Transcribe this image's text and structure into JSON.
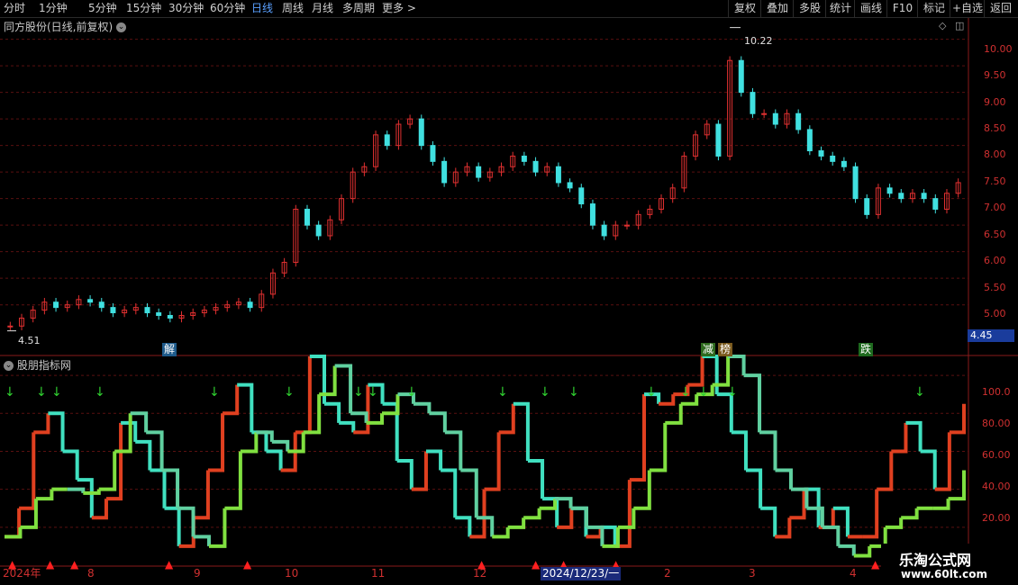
{
  "toolbar": {
    "periods": [
      "分时",
      "1分钟",
      "5分钟",
      "15分钟",
      "30分钟",
      "60分钟",
      "日线",
      "周线",
      "月线",
      "多周期",
      "更多 >"
    ],
    "active_period": "日线",
    "actions": [
      "复权",
      "叠加",
      "多股",
      "统计",
      "画线",
      "F10",
      "标记",
      "+自选",
      "返回"
    ]
  },
  "main_panel": {
    "title": "同方股份(日线,前复权)",
    "high_label": "10.22",
    "low_label": "4.51",
    "price_axis": [
      "10.00",
      "9.50",
      "9.00",
      "8.50",
      "8.00",
      "7.50",
      "7.00",
      "6.50",
      "6.00",
      "5.50",
      "5.00"
    ],
    "current_price_tag": "4.45",
    "markers": [
      {
        "text": "解",
        "color": "#2a6a9a"
      },
      {
        "text": "减",
        "color": "#3a7a2a"
      },
      {
        "text": "榜",
        "color": "#8a6a2a"
      },
      {
        "text": "跌",
        "color": "#2a7a2a"
      }
    ],
    "up_color": "#e03030",
    "down_color": "#40e0e0"
  },
  "indicator_panel": {
    "title": "股朋指标网",
    "axis": [
      "100.0",
      "80.00",
      "60.00",
      "40.00",
      "20.00"
    ]
  },
  "date_axis": {
    "labels": [
      "2024年",
      "8",
      "9",
      "10",
      "11",
      "12",
      "2",
      "3",
      "4"
    ],
    "highlight": "2024/12/23/一"
  },
  "watermark": {
    "title": "乐淘公式网",
    "url": "www.60lt.com"
  },
  "chart_data": {
    "type": "candlestick",
    "title": "同方股份(日线,前复权)",
    "ylim": [
      4.3,
      10.4
    ],
    "y_ticks": [
      5.0,
      5.5,
      6.0,
      6.5,
      7.0,
      7.5,
      8.0,
      8.5,
      9.0,
      9.5,
      10.0
    ],
    "annotated_high": 10.22,
    "annotated_low": 4.51,
    "close_path": [
      4.6,
      4.75,
      4.9,
      5.05,
      4.95,
      5.0,
      5.1,
      5.05,
      4.95,
      4.85,
      4.9,
      4.95,
      4.85,
      4.8,
      4.75,
      4.8,
      4.85,
      4.9,
      4.95,
      5.0,
      5.05,
      4.95,
      5.2,
      5.6,
      5.8,
      6.8,
      6.5,
      6.3,
      6.6,
      7.0,
      7.5,
      7.6,
      8.2,
      8.0,
      8.4,
      8.5,
      8.0,
      7.7,
      7.3,
      7.5,
      7.6,
      7.4,
      7.5,
      7.6,
      7.8,
      7.7,
      7.5,
      7.6,
      7.3,
      7.2,
      6.9,
      6.5,
      6.3,
      6.5,
      6.5,
      6.7,
      6.8,
      7.0,
      7.2,
      7.8,
      8.2,
      8.4,
      7.8,
      9.6,
      9.0,
      8.6,
      8.6,
      8.4,
      8.6,
      8.3,
      7.9,
      7.8,
      7.7,
      7.6,
      7.0,
      6.7,
      7.2,
      7.1,
      7.0,
      7.1,
      7.0,
      6.8,
      7.1,
      7.3
    ],
    "indicator": {
      "ylim": [
        0,
        110
      ],
      "y_ticks": [
        20,
        40,
        60,
        80,
        100
      ],
      "series": [
        {
          "values": [
            15,
            30,
            70,
            80,
            60,
            45,
            25,
            35,
            75,
            65,
            50,
            30,
            10,
            25,
            50,
            80,
            95,
            70,
            60,
            50,
            70,
            110,
            85,
            75,
            70,
            95,
            85,
            55,
            40,
            60,
            50,
            25,
            15,
            40,
            70,
            85,
            55,
            35,
            20,
            30,
            15,
            20,
            10,
            45,
            90,
            85,
            90,
            95,
            110,
            90,
            70,
            50,
            30,
            15,
            25,
            40,
            20,
            30,
            15,
            15,
            40,
            60,
            75,
            60,
            40,
            70,
            85
          ]
        },
        {
          "values": [
            15,
            20,
            35,
            40,
            40,
            38,
            40,
            60,
            80,
            70,
            50,
            30,
            15,
            10,
            30,
            60,
            70,
            65,
            60,
            70,
            90,
            105,
            80,
            75,
            80,
            90,
            85,
            80,
            70,
            50,
            25,
            15,
            20,
            25,
            30,
            35,
            30,
            20,
            10,
            20,
            30,
            50,
            75,
            85,
            90,
            95,
            110,
            100,
            70,
            50,
            40,
            30,
            20,
            10,
            5,
            10,
            20,
            25,
            30,
            30,
            35,
            50
          ]
        }
      ]
    }
  }
}
